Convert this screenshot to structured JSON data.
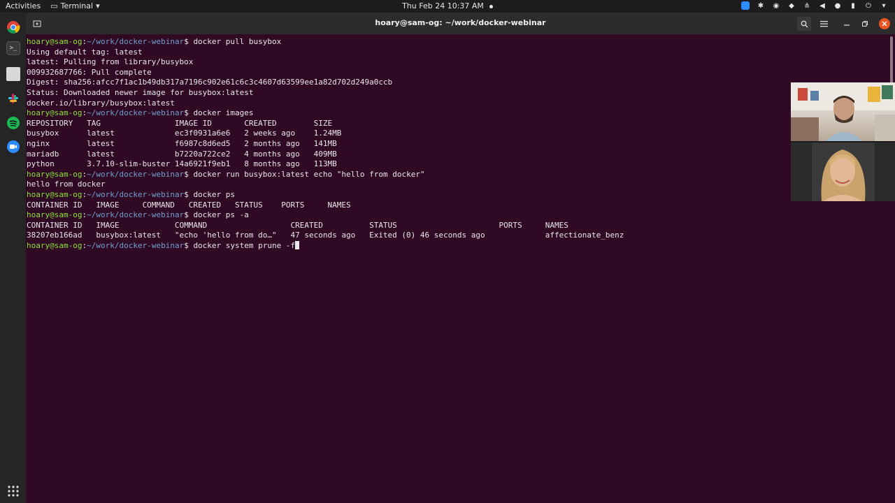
{
  "topbar": {
    "activities": "Activities",
    "app_name": "Terminal",
    "clock": "Thu Feb 24  10:37 AM"
  },
  "window": {
    "title": "hoary@sam-og: ~/work/docker-webinar"
  },
  "prompt": {
    "user": "hoary@sam-og",
    "path": "~/work/docker-webinar"
  },
  "terminal": {
    "lines": [
      {
        "type": "cmd",
        "text": "docker pull busybox"
      },
      {
        "type": "out",
        "text": "Using default tag: latest"
      },
      {
        "type": "out",
        "text": "latest: Pulling from library/busybox"
      },
      {
        "type": "out",
        "text": "009932687766: Pull complete"
      },
      {
        "type": "out",
        "text": "Digest: sha256:afcc7f1ac1b49db317a7196c902e61c6c3c4607d63599ee1a82d702d249a0ccb"
      },
      {
        "type": "out",
        "text": "Status: Downloaded newer image for busybox:latest"
      },
      {
        "type": "out",
        "text": "docker.io/library/busybox:latest"
      },
      {
        "type": "cmd",
        "text": "docker images"
      },
      {
        "type": "out",
        "text": "REPOSITORY   TAG                IMAGE ID       CREATED        SIZE"
      },
      {
        "type": "out",
        "text": "busybox      latest             ec3f0931a6e6   2 weeks ago    1.24MB"
      },
      {
        "type": "out",
        "text": "nginx        latest             f6987c8d6ed5   2 months ago   141MB"
      },
      {
        "type": "out",
        "text": "mariadb      latest             b7220a722ce2   4 months ago   409MB"
      },
      {
        "type": "out",
        "text": "python       3.7.10-slim-buster 14a6921f9eb1   8 months ago   113MB"
      },
      {
        "type": "cmd",
        "text": "docker run busybox:latest echo \"hello from docker\""
      },
      {
        "type": "out",
        "text": "hello from docker"
      },
      {
        "type": "cmd",
        "text": "docker ps"
      },
      {
        "type": "out",
        "text": "CONTAINER ID   IMAGE     COMMAND   CREATED   STATUS    PORTS     NAMES"
      },
      {
        "type": "cmd",
        "text": "docker ps -a"
      },
      {
        "type": "out",
        "text": "CONTAINER ID   IMAGE            COMMAND                  CREATED          STATUS                      PORTS     NAMES"
      },
      {
        "type": "out",
        "text": "38207eb166ad   busybox:latest   \"echo 'hello from do…\"   47 seconds ago   Exited (0) 46 seconds ago             affectionate_benz"
      },
      {
        "type": "input",
        "text": "docker system prune -f"
      }
    ]
  },
  "colors": {
    "terminal_bg": "#300a24",
    "prompt_user": "#8ae234",
    "prompt_path": "#729fcf",
    "accent_close": "#e95420"
  },
  "dock": {
    "items": [
      "chrome-icon",
      "terminal-icon",
      "files-icon",
      "slack-icon",
      "spotify-icon",
      "zoom-icon"
    ]
  }
}
